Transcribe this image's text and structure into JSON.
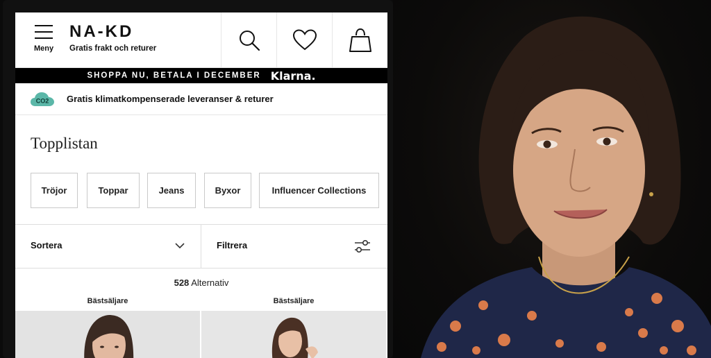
{
  "header": {
    "menu_label": "Meny",
    "logo": "NA-KD",
    "tagline": "Gratis frakt och returer",
    "icons": [
      "search-icon",
      "heart-icon",
      "bag-icon"
    ]
  },
  "promo": {
    "text": "SHOPPA NU, BETALA I DECEMBER",
    "brand": "Klarna."
  },
  "climate": {
    "badge": "CO2",
    "text": "Gratis klimatkompenserade leveranser & returer"
  },
  "page_title": "Topplistan",
  "categories": [
    "Tröjor",
    "Toppar",
    "Jeans",
    "Byxor",
    "Influencer Collections"
  ],
  "controls": {
    "sort_label": "Sortera",
    "filter_label": "Filtrera"
  },
  "results": {
    "count": "528",
    "label": "Alternativ"
  },
  "products": [
    {
      "badge": "Bästsäljare"
    },
    {
      "badge": "Bästsäljare"
    }
  ],
  "colors": {
    "accent_teal": "#5bb7a8",
    "black": "#000000",
    "border": "#c9c9c9"
  }
}
